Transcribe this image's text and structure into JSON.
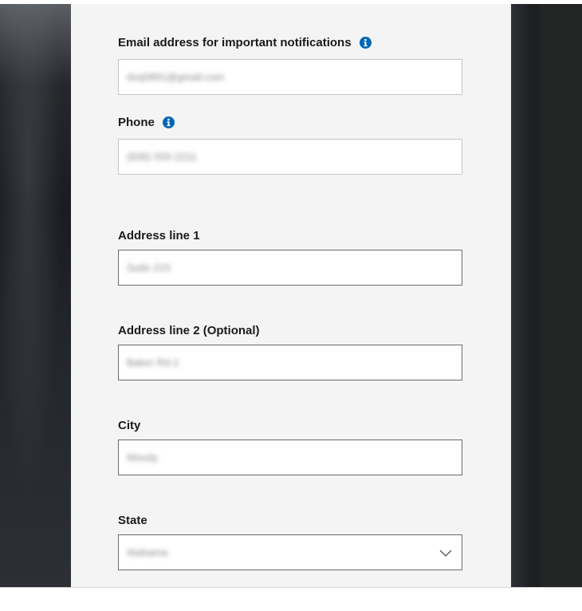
{
  "form": {
    "email": {
      "label": "Email address for important notifications",
      "value": "dvq0891@gmail.com",
      "icon": "info-icon"
    },
    "phone": {
      "label": "Phone",
      "value": "(836) 555-2211",
      "icon": "info-icon"
    },
    "address1": {
      "label": "Address line 1",
      "value": "Suite 215"
    },
    "address2": {
      "label": "Address line 2 (Optional)",
      "value": "Baker Rd 2"
    },
    "city": {
      "label": "City",
      "value": "Moody"
    },
    "state": {
      "label": "State",
      "value": "Alabama",
      "icon": "chevron-down-icon"
    }
  },
  "colors": {
    "panel": "#f4f4f4",
    "accent": "#0067b8",
    "label": "#1b1b1b"
  }
}
